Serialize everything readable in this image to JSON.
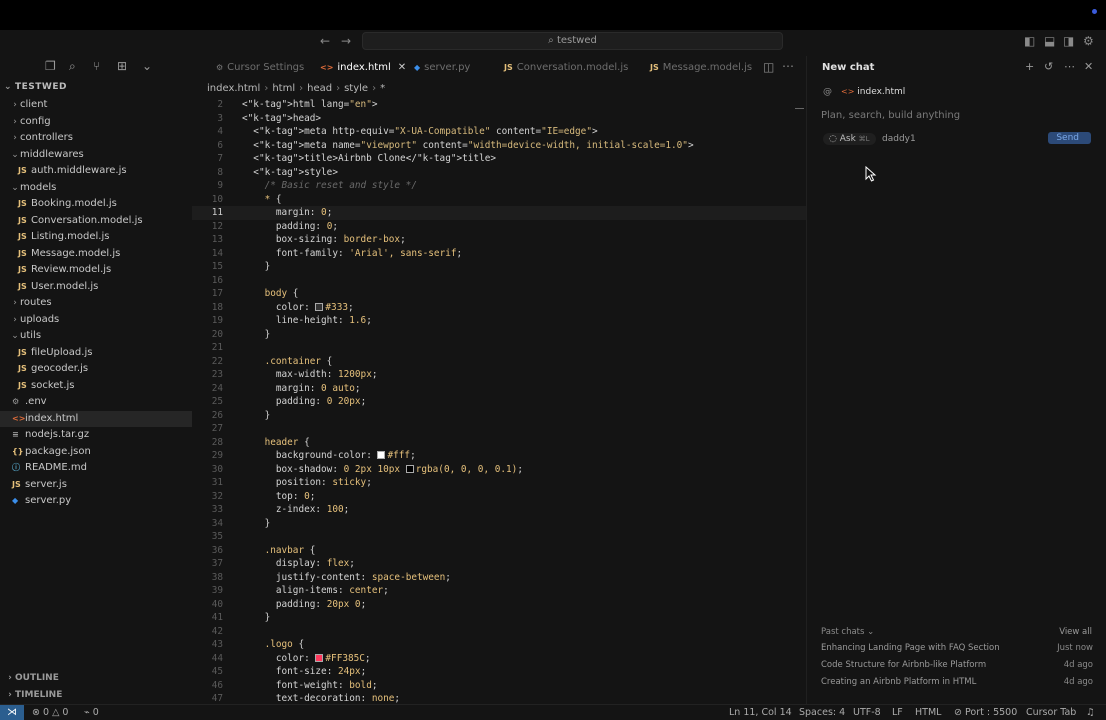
{
  "window": {
    "search_text": "testwed",
    "colors": {
      "accent": "#2b5e8f",
      "background": "#141414",
      "active_row": "#262626"
    }
  },
  "explorer": {
    "title": "TESTWED",
    "items": [
      {
        "label": "client",
        "kind": "folder",
        "open": false,
        "depth": 1
      },
      {
        "label": "config",
        "kind": "folder",
        "open": false,
        "depth": 1
      },
      {
        "label": "controllers",
        "kind": "folder",
        "open": false,
        "depth": 1
      },
      {
        "label": "middlewares",
        "kind": "folder",
        "open": true,
        "depth": 1
      },
      {
        "label": "auth.middleware.js",
        "kind": "js",
        "depth": 2
      },
      {
        "label": "models",
        "kind": "folder",
        "open": true,
        "depth": 1
      },
      {
        "label": "Booking.model.js",
        "kind": "js",
        "depth": 2
      },
      {
        "label": "Conversation.model.js",
        "kind": "js",
        "depth": 2
      },
      {
        "label": "Listing.model.js",
        "kind": "js",
        "depth": 2
      },
      {
        "label": "Message.model.js",
        "kind": "js",
        "depth": 2
      },
      {
        "label": "Review.model.js",
        "kind": "js",
        "depth": 2
      },
      {
        "label": "User.model.js",
        "kind": "js",
        "depth": 2
      },
      {
        "label": "routes",
        "kind": "folder",
        "open": false,
        "depth": 1
      },
      {
        "label": "uploads",
        "kind": "folder",
        "open": false,
        "depth": 1
      },
      {
        "label": "utils",
        "kind": "folder",
        "open": true,
        "depth": 1
      },
      {
        "label": "fileUpload.js",
        "kind": "js",
        "depth": 2
      },
      {
        "label": "geocoder.js",
        "kind": "js",
        "depth": 2
      },
      {
        "label": "socket.js",
        "kind": "js",
        "depth": 2
      },
      {
        "label": ".env",
        "kind": "env",
        "depth": 1
      },
      {
        "label": "index.html",
        "kind": "html",
        "depth": 1,
        "active": true
      },
      {
        "label": "nodejs.tar.gz",
        "kind": "gz",
        "depth": 1
      },
      {
        "label": "package.json",
        "kind": "json",
        "depth": 1
      },
      {
        "label": "README.md",
        "kind": "md",
        "depth": 1
      },
      {
        "label": "server.js",
        "kind": "js",
        "depth": 1
      },
      {
        "label": "server.py",
        "kind": "py",
        "depth": 1
      }
    ],
    "outline_label": "OUTLINE",
    "timeline_label": "TIMELINE"
  },
  "tabs": [
    {
      "label": "Cursor Settings",
      "icon": "",
      "active": false
    },
    {
      "label": "index.html",
      "icon": "<>",
      "active": true
    },
    {
      "label": "server.py",
      "icon": "py",
      "active": false
    },
    {
      "label": "Conversation.model.js",
      "icon": "JS",
      "active": false
    },
    {
      "label": "Message.model.js",
      "icon": "JS",
      "active": false
    }
  ],
  "breadcrumb": [
    "index.html",
    "html",
    "head",
    "style",
    "*"
  ],
  "editor": {
    "current_line": 11,
    "lines": [
      {
        "n": "2",
        "t": "<html lang=\"en\">"
      },
      {
        "n": "3",
        "t": "<head>"
      },
      {
        "n": "4",
        "t": "  <meta http-equiv=\"X-UA-Compatible\" content=\"IE=edge\">"
      },
      {
        "n": "6",
        "t": "  <meta name=\"viewport\" content=\"width=device-width, initial-scale=1.0\">"
      },
      {
        "n": "7",
        "t": "  <title>Airbnb Clone</title>"
      },
      {
        "n": "8",
        "t": "  <style>"
      },
      {
        "n": "9",
        "t": "    /* Basic reset and style */",
        "c": true
      },
      {
        "n": "10",
        "t": "    * {"
      },
      {
        "n": "11",
        "t": "      margin: 0;"
      },
      {
        "n": "12",
        "t": "      padding: 0;"
      },
      {
        "n": "13",
        "t": "      box-sizing: border-box;"
      },
      {
        "n": "14",
        "t": "      font-family: 'Arial', sans-serif;"
      },
      {
        "n": "15",
        "t": "    }"
      },
      {
        "n": "16",
        "t": ""
      },
      {
        "n": "17",
        "t": "    body {"
      },
      {
        "n": "18",
        "t": "      color: #333;",
        "sw": "#333333"
      },
      {
        "n": "19",
        "t": "      line-height: 1.6;"
      },
      {
        "n": "20",
        "t": "    }"
      },
      {
        "n": "21",
        "t": ""
      },
      {
        "n": "22",
        "t": "    .container {"
      },
      {
        "n": "23",
        "t": "      max-width: 1200px;"
      },
      {
        "n": "24",
        "t": "      margin: 0 auto;"
      },
      {
        "n": "25",
        "t": "      padding: 0 20px;"
      },
      {
        "n": "26",
        "t": "    }"
      },
      {
        "n": "27",
        "t": ""
      },
      {
        "n": "28",
        "t": "    header {"
      },
      {
        "n": "29",
        "t": "      background-color: #fff;",
        "sw": "#ffffff"
      },
      {
        "n": "30",
        "t": "      box-shadow: 0 2px 10px rgba(0, 0, 0, 0.1);",
        "sw": "#000000"
      },
      {
        "n": "31",
        "t": "      position: sticky;"
      },
      {
        "n": "32",
        "t": "      top: 0;"
      },
      {
        "n": "33",
        "t": "      z-index: 100;"
      },
      {
        "n": "34",
        "t": "    }"
      },
      {
        "n": "35",
        "t": ""
      },
      {
        "n": "36",
        "t": "    .navbar {"
      },
      {
        "n": "37",
        "t": "      display: flex;"
      },
      {
        "n": "38",
        "t": "      justify-content: space-between;"
      },
      {
        "n": "39",
        "t": "      align-items: center;"
      },
      {
        "n": "40",
        "t": "      padding: 20px 0;"
      },
      {
        "n": "41",
        "t": "    }"
      },
      {
        "n": "42",
        "t": ""
      },
      {
        "n": "43",
        "t": "    .logo {"
      },
      {
        "n": "44",
        "t": "      color: #FF385C;",
        "sw": "#FF385C"
      },
      {
        "n": "45",
        "t": "      font-size: 24px;"
      },
      {
        "n": "46",
        "t": "      font-weight: bold;"
      },
      {
        "n": "47",
        "t": "      text-decoration: none;"
      }
    ]
  },
  "chat": {
    "title": "New chat",
    "context_file": "index.html",
    "input_placeholder": "Plan, search, build anything",
    "mode_label": "Ask",
    "mode_shortcut": "⌘L",
    "model_label": "daddy1",
    "send_label": "Send",
    "past_chats_label": "Past chats",
    "view_all_label": "View all",
    "past_chats": [
      {
        "title": "Enhancing Landing Page with FAQ Section",
        "when": "Just now"
      },
      {
        "title": "Code Structure for Airbnb-like Platform",
        "when": "4d ago"
      },
      {
        "title": "Creating an Airbnb Platform in HTML",
        "when": "4d ago"
      }
    ]
  },
  "status": {
    "errors": "0",
    "warnings": "0",
    "ports": "0",
    "position": "Ln 11, Col 14",
    "spaces": "Spaces: 4",
    "encoding": "UTF-8",
    "eol": "LF",
    "language": "HTML",
    "port": "Port : 5500",
    "cursor_tab": "Cursor Tab"
  }
}
